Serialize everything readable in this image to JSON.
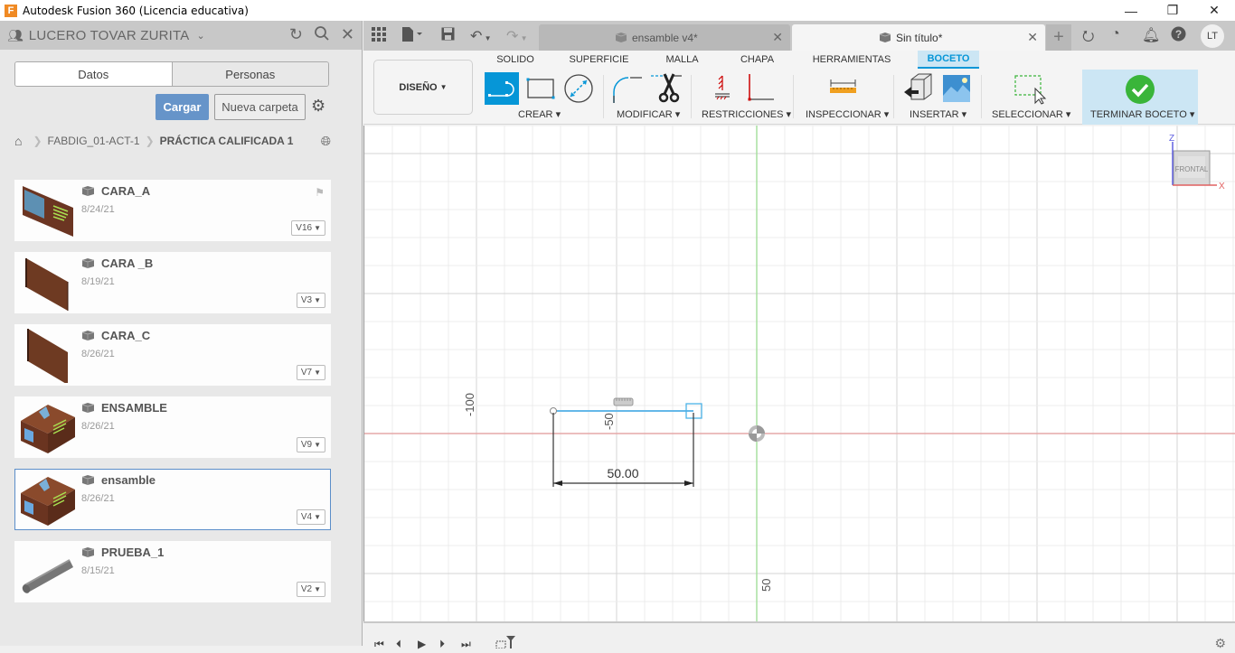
{
  "window": {
    "title": "Autodesk Fusion 360 (Licencia educativa)",
    "app_icon_letter": "F",
    "controls": {
      "minimize": "—",
      "restore": "❐",
      "close": "✕"
    }
  },
  "data_panel": {
    "user_name": "LUCERO TOVAR ZURITA",
    "segments": [
      "Datos",
      "Personas"
    ],
    "active_segment": "Datos",
    "upload_label": "Cargar",
    "new_folder_label": "Nueva carpeta",
    "breadcrumb": [
      "FABDIG_01-ACT-1",
      "PRÁCTICA CALIFICADA 1"
    ],
    "files": [
      {
        "name": "CARA_A",
        "date": "8/24/21",
        "version": "V16",
        "thumb": "panel-decorated",
        "flag": true,
        "selected": false
      },
      {
        "name": "CARA _B",
        "date": "8/19/21",
        "version": "V3",
        "thumb": "panel-wood",
        "flag": false,
        "selected": false
      },
      {
        "name": "CARA_C",
        "date": "8/26/21",
        "version": "V7",
        "thumb": "panel-wood-2",
        "flag": false,
        "selected": false
      },
      {
        "name": "ENSAMBLE",
        "date": "8/26/21",
        "version": "V9",
        "thumb": "box",
        "flag": false,
        "selected": false
      },
      {
        "name": "ensamble",
        "date": "8/26/21",
        "version": "V4",
        "thumb": "box",
        "flag": false,
        "selected": true
      },
      {
        "name": "PRUEBA_1",
        "date": "8/15/21",
        "version": "V2",
        "thumb": "cylinder",
        "flag": false,
        "selected": false
      }
    ]
  },
  "appbar": {
    "tabs": [
      {
        "label": "ensamble v4*",
        "active": false
      },
      {
        "label": "Sin título*",
        "active": true
      }
    ],
    "avatar_initials": "LT"
  },
  "toolbar": {
    "workspace": "DISEÑO",
    "ribbon_tabs": [
      "SOLIDO",
      "SUPERFICIE",
      "MALLA",
      "CHAPA",
      "HERRAMIENTAS",
      "BOCETO"
    ],
    "active_ribbon_tab": "BOCETO",
    "groups": [
      "CREAR",
      "MODIFICAR",
      "RESTRICCIONES",
      "INSPECCIONAR",
      "INSERTAR",
      "SELECCIONAR",
      "TERMINAR BOCETO"
    ],
    "accent_color": "#0696d7",
    "finish_color": "#3ab53a"
  },
  "canvas": {
    "axis_labels": {
      "minus100": "-100",
      "minus50": "-50",
      "plus50": "50"
    },
    "dimension_value": "50.00",
    "viewcube": {
      "face": "FRONTAL",
      "axis_z": "Z",
      "axis_x": "X"
    }
  },
  "timeline": {
    "controls": [
      "first",
      "previous",
      "play",
      "next",
      "last"
    ]
  }
}
